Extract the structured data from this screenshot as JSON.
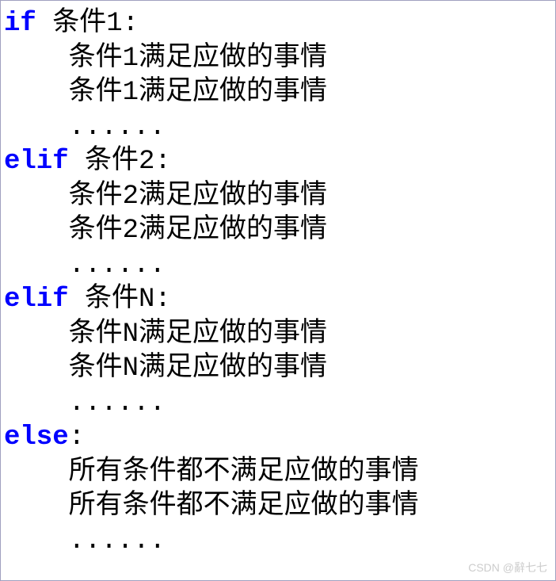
{
  "code": {
    "lines": [
      {
        "keyword": "if",
        "rest": " 条件1:"
      },
      {
        "indent": "    ",
        "text": "条件1满足应做的事情"
      },
      {
        "indent": "    ",
        "text": "条件1满足应做的事情"
      },
      {
        "indent": "    ",
        "text": "......"
      },
      {
        "keyword": "elif",
        "rest": " 条件2:"
      },
      {
        "indent": "    ",
        "text": "条件2满足应做的事情"
      },
      {
        "indent": "    ",
        "text": "条件2满足应做的事情"
      },
      {
        "indent": "    ",
        "text": "......"
      },
      {
        "keyword": "elif",
        "rest": " 条件N:"
      },
      {
        "indent": "    ",
        "text": "条件N满足应做的事情"
      },
      {
        "indent": "    ",
        "text": "条件N满足应做的事情"
      },
      {
        "indent": "    ",
        "text": "......"
      },
      {
        "keyword": "else",
        "rest": ":"
      },
      {
        "indent": "    ",
        "text": "所有条件都不满足应做的事情"
      },
      {
        "indent": "    ",
        "text": "所有条件都不满足应做的事情"
      },
      {
        "indent": "    ",
        "text": "......"
      }
    ]
  },
  "watermark": "CSDN @辭七七"
}
